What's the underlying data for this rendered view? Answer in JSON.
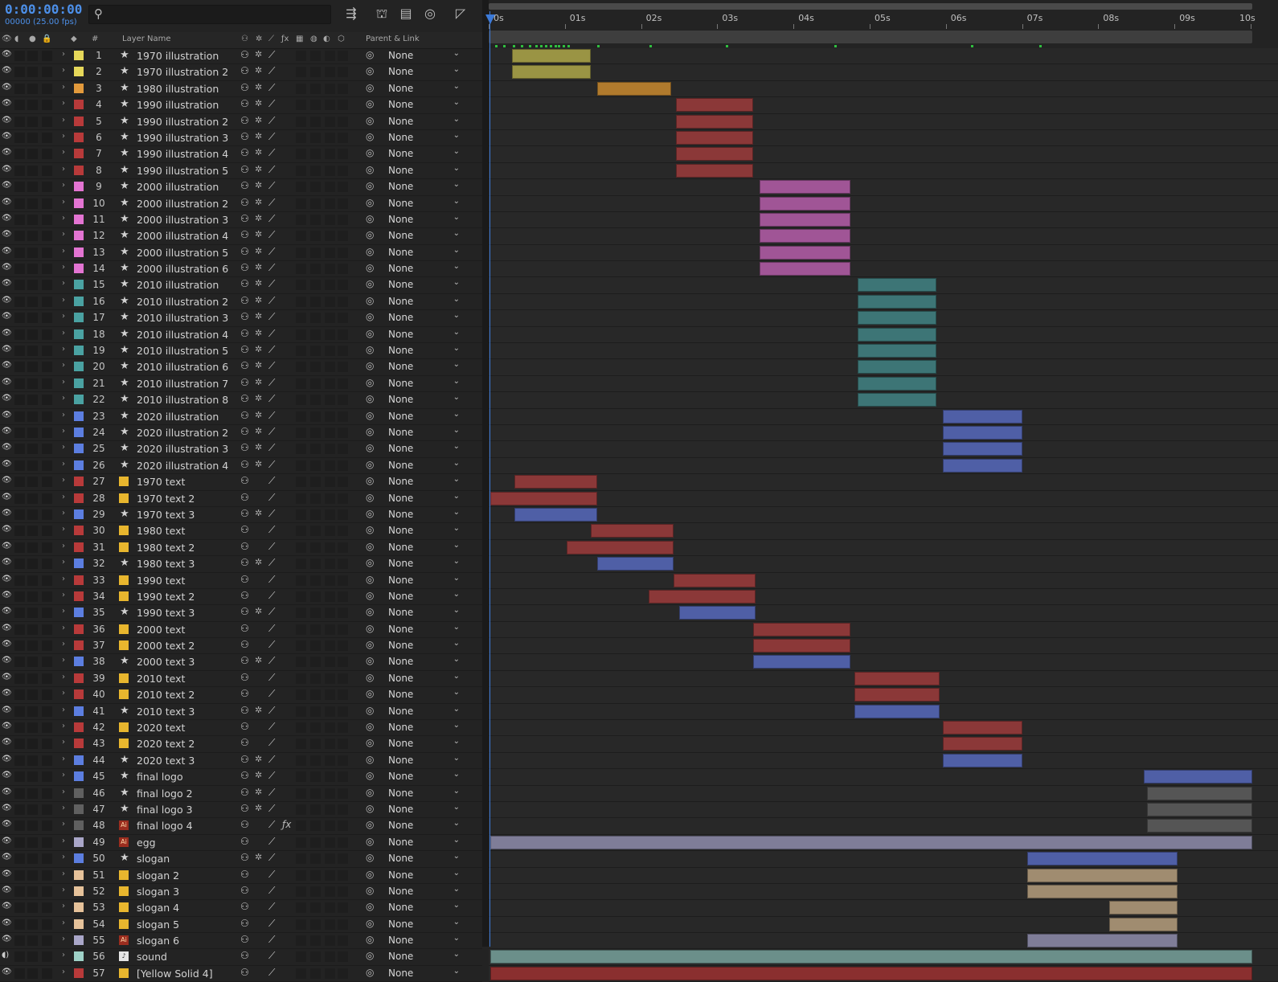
{
  "header": {
    "timecode": "0:00:00:00",
    "fps": "00000 (25.00 fps)",
    "col_layer_name": "Layer Name",
    "col_parent": "Parent & Link",
    "col_num": "#"
  },
  "ruler": [
    "0s",
    "01s",
    "02s",
    "03s",
    "04s",
    "05s",
    "06s",
    "07s",
    "08s",
    "09s",
    "10s"
  ],
  "colors": {
    "yellow": "#e6d85a",
    "orange": "#e39a3c",
    "red": "#b83a3a",
    "pink": "#e374d2",
    "teal": "#4aa2a2",
    "blue": "#5c7ee0",
    "gray": "#606060",
    "lavender": "#a9a6c8",
    "peach": "#e6c29a",
    "mint": "#9fd2c8",
    "bar_yellow": "#9a9444",
    "bar_orange": "#b07a2d",
    "bar_red": "#8b3838",
    "bar_pink": "#a05596",
    "bar_teal": "#3d7576",
    "bar_blue": "#4f5fa6",
    "bar_gray": "#555555",
    "bar_lav": "#7f7d98",
    "bar_peach": "#a08c70",
    "bar_mint": "#6b8f8a",
    "bar_redsolid": "#8a2f2f"
  },
  "layers": [
    {
      "num": "1",
      "name": "1970 illustration",
      "label": "yellow",
      "type": "star",
      "parent": "None",
      "bar": [
        0.28,
        1.32
      ],
      "bc": "bar_yellow",
      "shy": true
    },
    {
      "num": "2",
      "name": "1970 illustration 2",
      "label": "yellow",
      "type": "star",
      "parent": "None",
      "bar": [
        0.28,
        1.32
      ],
      "bc": "bar_yellow"
    },
    {
      "num": "3",
      "name": "1980 illustration",
      "label": "orange",
      "type": "star",
      "parent": "None",
      "bar": [
        1.4,
        2.37
      ],
      "bc": "bar_orange"
    },
    {
      "num": "4",
      "name": "1990 illustration",
      "label": "red",
      "type": "star",
      "parent": "None",
      "bar": [
        2.44,
        3.45
      ],
      "bc": "bar_red"
    },
    {
      "num": "5",
      "name": "1990 illustration 2",
      "label": "red",
      "type": "star",
      "parent": "None",
      "bar": [
        2.44,
        3.45
      ],
      "bc": "bar_red"
    },
    {
      "num": "6",
      "name": "1990 illustration 3",
      "label": "red",
      "type": "star",
      "parent": "None",
      "bar": [
        2.44,
        3.45
      ],
      "bc": "bar_red"
    },
    {
      "num": "7",
      "name": "1990 illustration 4",
      "label": "red",
      "type": "star",
      "parent": "None",
      "bar": [
        2.44,
        3.45
      ],
      "bc": "bar_red"
    },
    {
      "num": "8",
      "name": "1990 illustration 5",
      "label": "red",
      "type": "star",
      "parent": "None",
      "bar": [
        2.44,
        3.45
      ],
      "bc": "bar_red"
    },
    {
      "num": "9",
      "name": "2000 illustration",
      "label": "pink",
      "type": "star",
      "parent": "None",
      "bar": [
        3.53,
        4.73
      ],
      "bc": "bar_pink"
    },
    {
      "num": "10",
      "name": "2000 illustration 2",
      "label": "pink",
      "type": "star",
      "parent": "None",
      "bar": [
        3.53,
        4.73
      ],
      "bc": "bar_pink"
    },
    {
      "num": "11",
      "name": "2000 illustration 3",
      "label": "pink",
      "type": "star",
      "parent": "None",
      "bar": [
        3.53,
        4.73
      ],
      "bc": "bar_pink"
    },
    {
      "num": "12",
      "name": "2000 illustration 4",
      "label": "pink",
      "type": "star",
      "parent": "None",
      "bar": [
        3.53,
        4.73
      ],
      "bc": "bar_pink"
    },
    {
      "num": "13",
      "name": "2000 illustration 5",
      "label": "pink",
      "type": "star",
      "parent": "None",
      "bar": [
        3.53,
        4.73
      ],
      "bc": "bar_pink"
    },
    {
      "num": "14",
      "name": "2000 illustration 6",
      "label": "pink",
      "type": "star",
      "parent": "None",
      "bar": [
        3.53,
        4.73
      ],
      "bc": "bar_pink"
    },
    {
      "num": "15",
      "name": "2010 illustration",
      "label": "teal",
      "type": "star",
      "parent": "None",
      "bar": [
        4.82,
        5.85
      ],
      "bc": "bar_teal"
    },
    {
      "num": "16",
      "name": "2010 illustration 2",
      "label": "teal",
      "type": "star",
      "parent": "None",
      "bar": [
        4.82,
        5.85
      ],
      "bc": "bar_teal"
    },
    {
      "num": "17",
      "name": "2010 illustration 3",
      "label": "teal",
      "type": "star",
      "parent": "None",
      "bar": [
        4.82,
        5.85
      ],
      "bc": "bar_teal"
    },
    {
      "num": "18",
      "name": "2010 illustration 4",
      "label": "teal",
      "type": "star",
      "parent": "None",
      "bar": [
        4.82,
        5.85
      ],
      "bc": "bar_teal"
    },
    {
      "num": "19",
      "name": "2010 illustration 5",
      "label": "teal",
      "type": "star",
      "parent": "None",
      "bar": [
        4.82,
        5.85
      ],
      "bc": "bar_teal"
    },
    {
      "num": "20",
      "name": "2010 illustration 6",
      "label": "teal",
      "type": "star",
      "parent": "None",
      "bar": [
        4.82,
        5.85
      ],
      "bc": "bar_teal"
    },
    {
      "num": "21",
      "name": "2010 illustration 7",
      "label": "teal",
      "type": "star",
      "parent": "None",
      "bar": [
        4.82,
        5.85
      ],
      "bc": "bar_teal"
    },
    {
      "num": "22",
      "name": "2010 illustration 8",
      "label": "teal",
      "type": "star",
      "parent": "None",
      "bar": [
        4.82,
        5.85
      ],
      "bc": "bar_teal"
    },
    {
      "num": "23",
      "name": "2020 illustration",
      "label": "blue",
      "type": "star",
      "parent": "None",
      "bar": [
        5.94,
        6.98
      ],
      "bc": "bar_blue"
    },
    {
      "num": "24",
      "name": "2020 illustration 2",
      "label": "blue",
      "type": "star",
      "parent": "None",
      "bar": [
        5.94,
        6.98
      ],
      "bc": "bar_blue"
    },
    {
      "num": "25",
      "name": "2020 illustration 3",
      "label": "blue",
      "type": "star",
      "parent": "None",
      "bar": [
        5.94,
        6.98
      ],
      "bc": "bar_blue"
    },
    {
      "num": "26",
      "name": "2020 illustration 4",
      "label": "blue",
      "type": "star",
      "parent": "None",
      "bar": [
        5.94,
        6.98
      ],
      "bc": "bar_blue"
    },
    {
      "num": "27",
      "name": "1970 text",
      "label": "red",
      "type": "comp",
      "parent": "None",
      "bar": [
        0.32,
        1.4
      ],
      "bc": "bar_red"
    },
    {
      "num": "28",
      "name": "1970 text 2",
      "label": "red",
      "type": "comp",
      "parent": "None",
      "bar": [
        0.0,
        1.4
      ],
      "bc": "bar_red"
    },
    {
      "num": "29",
      "name": "1970 text 3",
      "label": "blue",
      "type": "star",
      "parent": "None",
      "bar": [
        0.32,
        1.4
      ],
      "bc": "bar_blue"
    },
    {
      "num": "30",
      "name": "1980 text",
      "label": "red",
      "type": "comp",
      "parent": "None",
      "bar": [
        1.32,
        2.4
      ],
      "bc": "bar_red"
    },
    {
      "num": "31",
      "name": "1980 text 2",
      "label": "red",
      "type": "comp",
      "parent": "None",
      "bar": [
        1.0,
        2.4
      ],
      "bc": "bar_red"
    },
    {
      "num": "32",
      "name": "1980 text  3",
      "label": "blue",
      "type": "star",
      "parent": "None",
      "bar": [
        1.4,
        2.4
      ],
      "bc": "bar_blue"
    },
    {
      "num": "33",
      "name": "1990 text",
      "label": "red",
      "type": "comp",
      "parent": "None",
      "bar": [
        2.4,
        3.48
      ],
      "bc": "bar_red"
    },
    {
      "num": "34",
      "name": "1990 text 2",
      "label": "red",
      "type": "comp",
      "parent": "None",
      "bar": [
        2.08,
        3.48
      ],
      "bc": "bar_red"
    },
    {
      "num": "35",
      "name": "1990 text 3",
      "label": "blue",
      "type": "star",
      "parent": "None",
      "bar": [
        2.48,
        3.48
      ],
      "bc": "bar_blue"
    },
    {
      "num": "36",
      "name": "2000 text",
      "label": "red",
      "type": "comp",
      "parent": "None",
      "bar": [
        3.45,
        4.73
      ],
      "bc": "bar_red"
    },
    {
      "num": "37",
      "name": "2000 text 2",
      "label": "red",
      "type": "comp",
      "parent": "None",
      "bar": [
        3.45,
        4.73
      ],
      "bc": "bar_red"
    },
    {
      "num": "38",
      "name": "2000 text 3",
      "label": "blue",
      "type": "star",
      "parent": "None",
      "bar": [
        3.45,
        4.73
      ],
      "bc": "bar_blue"
    },
    {
      "num": "39",
      "name": "2010 text",
      "label": "red",
      "type": "comp",
      "parent": "None",
      "bar": [
        4.78,
        5.9
      ],
      "bc": "bar_red"
    },
    {
      "num": "40",
      "name": "2010 text 2",
      "label": "red",
      "type": "comp",
      "parent": "None",
      "bar": [
        4.78,
        5.9
      ],
      "bc": "bar_red"
    },
    {
      "num": "41",
      "name": "2010 text 3",
      "label": "blue",
      "type": "star",
      "parent": "None",
      "bar": [
        4.78,
        5.9
      ],
      "bc": "bar_blue"
    },
    {
      "num": "42",
      "name": "2020 text",
      "label": "red",
      "type": "comp",
      "parent": "None",
      "bar": [
        5.94,
        6.98
      ],
      "bc": "bar_red"
    },
    {
      "num": "43",
      "name": "2020 text 2",
      "label": "red",
      "type": "comp",
      "parent": "None",
      "bar": [
        5.94,
        6.98
      ],
      "bc": "bar_red"
    },
    {
      "num": "44",
      "name": "2020 text 3",
      "label": "blue",
      "type": "star",
      "parent": "None",
      "bar": [
        5.94,
        6.98
      ],
      "bc": "bar_blue"
    },
    {
      "num": "45",
      "name": "final logo",
      "label": "blue",
      "type": "star",
      "parent": "None",
      "bar": [
        8.58,
        10.0
      ],
      "bc": "bar_blue"
    },
    {
      "num": "46",
      "name": "final logo 2",
      "label": "gray",
      "type": "star",
      "parent": "None",
      "bar": [
        8.62,
        10.0
      ],
      "bc": "bar_gray"
    },
    {
      "num": "47",
      "name": "final logo 3",
      "label": "gray",
      "type": "star",
      "parent": "None",
      "bar": [
        8.62,
        10.0
      ],
      "bc": "bar_gray"
    },
    {
      "num": "48",
      "name": "final logo 4",
      "label": "gray",
      "type": "ai",
      "parent": "None",
      "bar": [
        8.62,
        10.0
      ],
      "bc": "bar_gray",
      "fx": true
    },
    {
      "num": "49",
      "name": "egg",
      "label": "lavender",
      "type": "ai",
      "parent": "None",
      "bar": [
        0.0,
        10.0
      ],
      "bc": "bar_lav"
    },
    {
      "num": "50",
      "name": "slogan",
      "label": "blue",
      "type": "star",
      "parent": "None",
      "bar": [
        7.05,
        9.02
      ],
      "bc": "bar_blue"
    },
    {
      "num": "51",
      "name": "slogan 2",
      "label": "peach",
      "type": "comp",
      "parent": "None",
      "bar": [
        7.05,
        9.02
      ],
      "bc": "bar_peach"
    },
    {
      "num": "52",
      "name": "slogan 3",
      "label": "peach",
      "type": "comp",
      "parent": "None",
      "bar": [
        7.05,
        9.02
      ],
      "bc": "bar_peach"
    },
    {
      "num": "53",
      "name": "slogan 4",
      "label": "peach",
      "type": "comp",
      "parent": "None",
      "bar": [
        8.12,
        9.02
      ],
      "bc": "bar_peach"
    },
    {
      "num": "54",
      "name": "slogan 5",
      "label": "peach",
      "type": "comp",
      "parent": "None",
      "bar": [
        8.12,
        9.02
      ],
      "bc": "bar_peach"
    },
    {
      "num": "55",
      "name": "slogan 6",
      "label": "lavender",
      "type": "ai",
      "parent": "None",
      "bar": [
        7.05,
        9.02
      ],
      "bc": "bar_lav"
    },
    {
      "num": "56",
      "name": "sound",
      "label": "mint",
      "type": "snd",
      "parent": "None",
      "bar": [
        0.0,
        10.0
      ],
      "bc": "bar_mint",
      "audio": true
    },
    {
      "num": "57",
      "name": "[Yellow Solid 4]",
      "label": "red",
      "type": "comp",
      "parent": "None",
      "bar": [
        0.0,
        10.0
      ],
      "bc": "bar_redsolid"
    }
  ]
}
